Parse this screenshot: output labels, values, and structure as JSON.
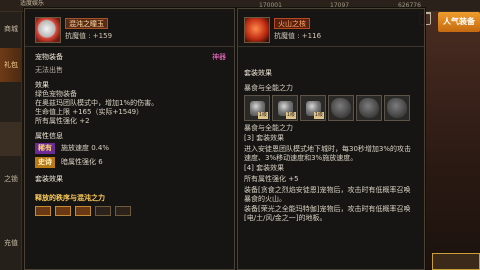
{
  "topbar": {
    "notice": "适度娱乐",
    "stat_a": "170001",
    "stat_b": "17097",
    "stat_c": "626776"
  },
  "left_rail": {
    "items": [
      {
        "label": "商城"
      },
      {
        "label": "礼包"
      },
      {
        "label": ""
      },
      {
        "label": ""
      },
      {
        "label": "之锁"
      },
      {
        "label": "充值"
      }
    ]
  },
  "right_ui": {
    "popular_label": "人气装备"
  },
  "left_panel": {
    "item_name": "混沌之瞳玉",
    "resist": "抗魔值 : +159",
    "section_pet": "宠物装备",
    "pet_tag": "神器",
    "pet_note": "无法出售",
    "section_effect": "效果",
    "effect_lines": [
      "绿色宠物装备",
      "在奥兹玛团队模式中，增加1%的伤害。",
      "生命值上限 +165（实际+1549）",
      "所有属性强化 +2"
    ],
    "section_attr": "属性信息",
    "attr_rows": [
      {
        "badge": "稀有",
        "text": "施放速度 0.4%"
      },
      {
        "badge": "史诗",
        "text": "暗属性强化 6"
      }
    ],
    "section_set": "套装效果",
    "set_name": "释放的秩序与混沌之力"
  },
  "right_panel": {
    "item_name": "火山之核",
    "resist": "抗魔值 : +116",
    "section_set": "套装效果",
    "set_subtitle": "暴食与全能之力",
    "slot_tags": [
      "1级",
      "1级",
      "1级"
    ],
    "set_subtitle_2": "暴食与全能之力",
    "lines": [
      "[3] 套装效果",
      "进入安徒恩团队模式地下城时，每30秒增加3%的攻击速度、3%移动速度和3%施放速度。",
      "[4] 套装效果",
      "所有属性强化 +5",
      "装备[贪食之烈焰安徒恩]宠物后，攻击时有低概率召唤暴食的火山。",
      "装备[荣光之全能玛特伽]宠物后，攻击时有低概率召唤[电/土/风/金之一]的地板。"
    ]
  }
}
